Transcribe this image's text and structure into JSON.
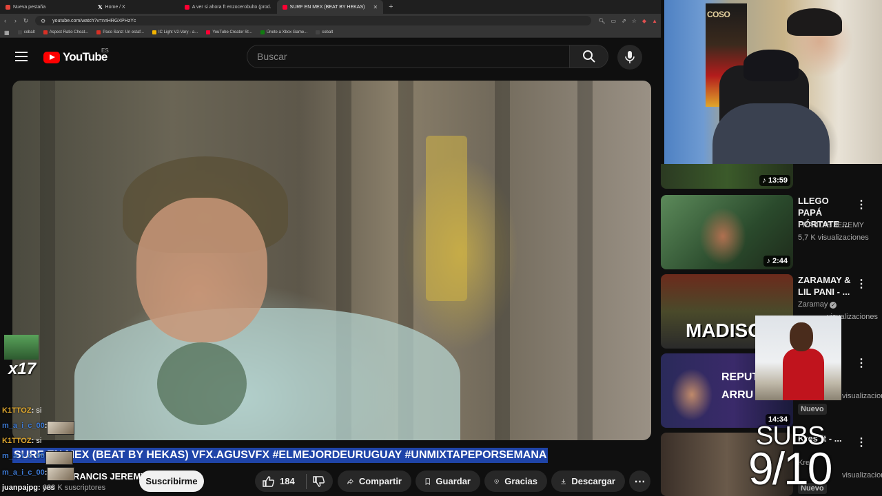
{
  "browser": {
    "tabs": [
      {
        "label": "Nueva pestaña",
        "color": "#e3453a"
      },
      {
        "label": "Home / X",
        "color": "#ffffff"
      },
      {
        "label": "A ver si ahora ft enzocerobulto (prod.",
        "color": "#ff0033"
      },
      {
        "label": "SURF EN MEX (BEAT BY HEKAS)",
        "color": "#ff0033",
        "active": true
      }
    ],
    "url": "youtube.com/watch?v=nnHRGXPHzYc",
    "bookmarks": [
      {
        "label": "cobalt",
        "color": "#444444"
      },
      {
        "label": "Aspect Ratio Cheat...",
        "color": "#d93025"
      },
      {
        "label": "Paco Sanz: Un estaf...",
        "color": "#d93025"
      },
      {
        "label": "IC Light V2-Vary - a...",
        "color": "#f4b400"
      },
      {
        "label": "YouTube Creator St...",
        "color": "#ff0033"
      },
      {
        "label": "Únete a Xbox Game...",
        "color": "#107c10"
      },
      {
        "label": "cobalt",
        "color": "#444444"
      }
    ]
  },
  "youtube": {
    "logo_text": "YouTube",
    "country_code": "ES",
    "search_placeholder": "Buscar"
  },
  "video": {
    "title_highlighted": "SURF EN MEX (BEAT BY HEKAS) VFX.AGUSVFX #ELMEJORDEURUGUAY #UNMIXTAPEPORSEMANA",
    "channel_name": "FRANCIS JEREMY",
    "subscribers": "338 K suscriptores",
    "subscribe_label": "Suscribirme",
    "like_count": "184",
    "share_label": "Compartir",
    "save_label": "Guardar",
    "thanks_label": "Gracias",
    "download_label": "Descargar"
  },
  "chat": {
    "badge_label": "x17",
    "messages": [
      {
        "user": "K1TTOZ",
        "text": "si",
        "color": "#e0a82e"
      },
      {
        "user": "m_a_i_c_00",
        "text": "",
        "color": "#3e7bd6"
      },
      {
        "user": "K1TTOZ",
        "text": "si",
        "color": "#e0a82e"
      },
      {
        "user": "m_a_i_c_00",
        "text": "",
        "color": "#3e7bd6"
      },
      {
        "user": "m_a_i_c_00",
        "text": "",
        "color": "#3e7bd6"
      },
      {
        "user": "juanpajpg",
        "text": "yes",
        "color": "#ffffff"
      }
    ]
  },
  "recommendations": [
    {
      "title": "",
      "channel": "",
      "views": "",
      "duration": "13:59"
    },
    {
      "title": "LLEGO PAPÁ PÓRTATE ...",
      "channel": "FRANCIS JEREMY",
      "views": "5,7 K visualizaciones",
      "duration": "2:44"
    },
    {
      "title": "ZARAMAY & LIL PANI - ...",
      "channel": "Zaramay",
      "views": "visualizaciones",
      "duration": "",
      "thumb_text": "MADISON"
    },
    {
      "title": "",
      "channel": "",
      "views": "visualizaciones",
      "duration": "14:34",
      "badge": "Nuevo",
      "thumb_text": "REPUT ARRU"
    },
    {
      "title": "Kres ft - ...",
      "channel": "Kres",
      "views": "visualizaciones",
      "duration": "",
      "badge": "Nuevo"
    }
  ],
  "overlay": {
    "subs_label": "SUBS",
    "subs_count": "9/10"
  },
  "colors": {
    "accent": "#ff0000",
    "background": "#0f0f0f",
    "selection": "#1f44a8"
  }
}
